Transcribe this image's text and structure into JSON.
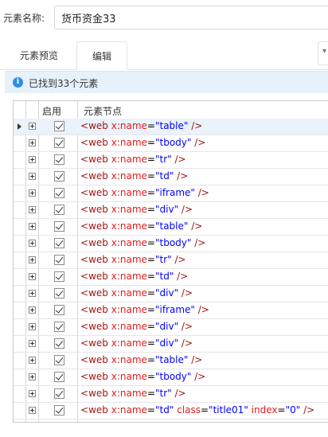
{
  "form": {
    "name_label": "元素名称:",
    "name_value": "货币资金33"
  },
  "tabs": [
    {
      "label": "元素预览",
      "active": false
    },
    {
      "label": "编辑",
      "active": true
    }
  ],
  "info": {
    "icon": "info-icon",
    "text": "已找到33个元素"
  },
  "grid": {
    "columns": [
      "启用",
      "元素节点"
    ],
    "rows": [
      {
        "enabled": true,
        "selected": true,
        "tag": "web",
        "name": "table",
        "extra": []
      },
      {
        "enabled": true,
        "tag": "web",
        "name": "tbody",
        "extra": []
      },
      {
        "enabled": true,
        "tag": "web",
        "name": "tr",
        "extra": []
      },
      {
        "enabled": true,
        "tag": "web",
        "name": "td",
        "extra": []
      },
      {
        "enabled": true,
        "tag": "web",
        "name": "iframe",
        "extra": []
      },
      {
        "enabled": true,
        "tag": "web",
        "name": "div",
        "extra": []
      },
      {
        "enabled": true,
        "tag": "web",
        "name": "table",
        "extra": []
      },
      {
        "enabled": true,
        "tag": "web",
        "name": "tbody",
        "extra": []
      },
      {
        "enabled": true,
        "tag": "web",
        "name": "tr",
        "extra": []
      },
      {
        "enabled": true,
        "tag": "web",
        "name": "td",
        "extra": []
      },
      {
        "enabled": true,
        "tag": "web",
        "name": "div",
        "extra": []
      },
      {
        "enabled": true,
        "tag": "web",
        "name": "iframe",
        "extra": []
      },
      {
        "enabled": true,
        "tag": "web",
        "name": "div",
        "extra": []
      },
      {
        "enabled": true,
        "tag": "web",
        "name": "div",
        "extra": []
      },
      {
        "enabled": true,
        "tag": "web",
        "name": "table",
        "extra": []
      },
      {
        "enabled": true,
        "tag": "web",
        "name": "tbody",
        "extra": []
      },
      {
        "enabled": true,
        "tag": "web",
        "name": "tr",
        "extra": []
      },
      {
        "enabled": true,
        "tag": "web",
        "name": "td",
        "extra": [
          {
            "attr": "class",
            "value": "title01"
          },
          {
            "attr": "index",
            "value": "0"
          }
        ]
      }
    ]
  },
  "colors": {
    "info_bg": "#e6f1fb",
    "info_icon": "#2f8ee6",
    "tag": "#a31515",
    "attr": "#e21c1c",
    "value": "#0000ff",
    "selected_row": "#eaf2fb"
  }
}
